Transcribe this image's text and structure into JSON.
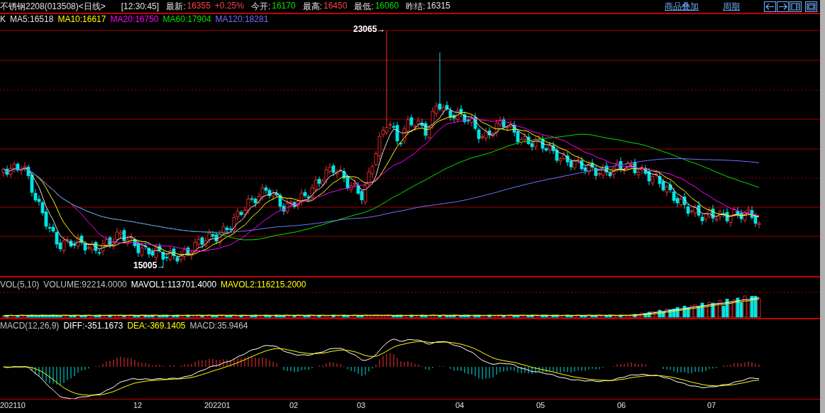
{
  "header": {
    "title": "不锈钢2208(013508)<日线>",
    "time": "[12:30:45]",
    "quotes": [
      {
        "label": "最新:",
        "value": "16355",
        "change": "+0.25%",
        "color": "#ff4040"
      },
      {
        "label": "今开:",
        "value": "16170",
        "color": "#00e000"
      },
      {
        "label": "最高:",
        "value": "16450",
        "color": "#ff4040"
      },
      {
        "label": "最低:",
        "value": "16060",
        "color": "#00e000"
      },
      {
        "label": "昨结:",
        "value": "16315",
        "color": "#e0e0e0"
      }
    ],
    "links": [
      "商品叠加",
      "周期"
    ]
  },
  "main_legend": [
    {
      "text": "K",
      "color": "#e0e0e0"
    },
    {
      "text": "MA5:16518",
      "color": "#e0e0e0"
    },
    {
      "text": "MA10:16617",
      "color": "#ffff00"
    },
    {
      "text": "MA20:16750",
      "color": "#ff00ff"
    },
    {
      "text": "MA60:17904",
      "color": "#00e000"
    },
    {
      "text": "MA120:18281",
      "color": "#7070ff"
    }
  ],
  "price_labels": [
    "23065→",
    "15005→"
  ],
  "volume_legend": [
    {
      "text": "VOL(5,10)",
      "color": "#c0c0c0"
    },
    {
      "text": "VOLUME:92214.0000",
      "color": "#c0c0c0"
    },
    {
      "text": "MAVOL1:113701.4000",
      "color": "#ffffff"
    },
    {
      "text": "MAVOL2:116215.2000",
      "color": "#ffff00"
    }
  ],
  "macd_legend": [
    {
      "text": "MACD(12,26,9)",
      "color": "#c0c0c0"
    },
    {
      "text": "DIFF:-351.1673",
      "color": "#ffffff"
    },
    {
      "text": "DEA:-369.1405",
      "color": "#ffff00"
    },
    {
      "text": "MACD:35.9464",
      "color": "#c0c0c0"
    }
  ],
  "date_axis": [
    "202110",
    "12",
    "202201",
    "02",
    "03",
    "04",
    "05",
    "06",
    "07"
  ]
}
